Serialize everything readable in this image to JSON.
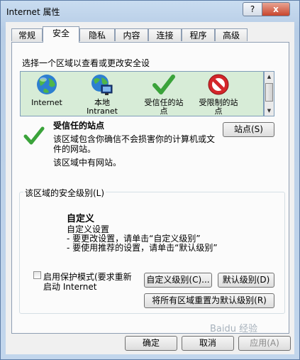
{
  "window": {
    "title": "Internet 属性",
    "help_label": "?",
    "close_label": "x"
  },
  "tabs": [
    {
      "label": "常规"
    },
    {
      "label": "安全",
      "active": true
    },
    {
      "label": "隐私"
    },
    {
      "label": "内容"
    },
    {
      "label": "连接"
    },
    {
      "label": "程序"
    },
    {
      "label": "高级"
    }
  ],
  "security": {
    "zone_prompt": "选择一个区域以查看或更改安全设",
    "zones": [
      {
        "label_line1": "Internet",
        "label_line2": "",
        "icon": "globe-icon"
      },
      {
        "label_line1": "本地",
        "label_line2": "Intranet",
        "icon": "intranet-icon"
      },
      {
        "label_line1": "受信任的站",
        "label_line2": "点",
        "icon": "checkmark-icon",
        "selected": true
      },
      {
        "label_line1": "受限制的站",
        "label_line2": "点",
        "icon": "no-entry-icon"
      }
    ],
    "selected_zone": {
      "title": "受信任的站点",
      "desc_line1": "该区域包含你确信不会损害你的计算机或文",
      "desc_line2": "件的网站。",
      "status": "该区域中有网站。",
      "sites_button": "站点(S)"
    },
    "level": {
      "group_title": "该区域的安全级别(L)",
      "name": "自定义",
      "line1": "自定义设置",
      "line2": "- 要更改设置，请单击“自定义级别”",
      "line3": "- 要使用推荐的设置，请单击“默认级别”"
    },
    "protected_mode": {
      "line1": "启用保护模式(要求重新",
      "line2": "启动 Internet",
      "checked": false
    },
    "custom_level_button": "自定义级别(C)...",
    "default_level_button": "默认级别(D)",
    "reset_all_button": "将所有区域重置为默认级别(R)"
  },
  "footer": {
    "ok": "确定",
    "cancel": "取消",
    "apply": "应用(A)"
  },
  "watermark": "Baidu 经验",
  "colors": {
    "zone_bg": "#d7ecd7",
    "check_green": "#3aa33a",
    "no_entry_red": "#d4262a"
  }
}
